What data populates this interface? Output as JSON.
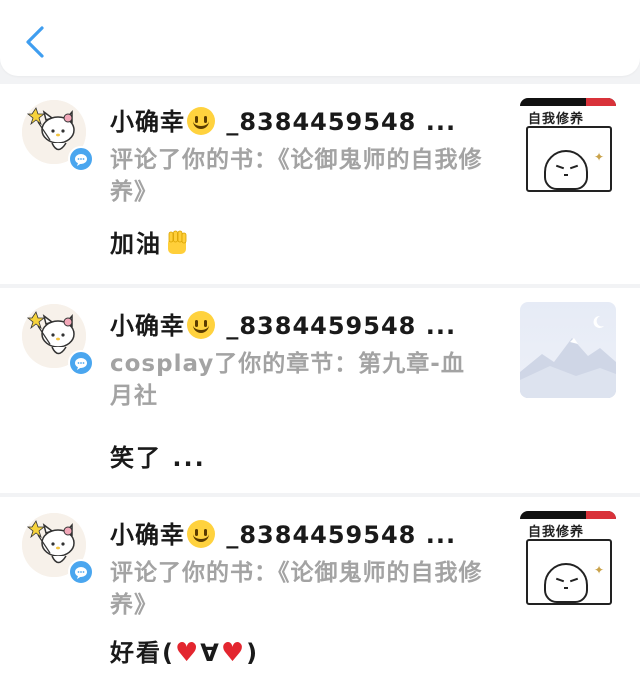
{
  "header": {
    "back_icon": "chevron-left-icon"
  },
  "items": [
    {
      "name_prefix": "小确幸",
      "name_suffix": " _8384459548 ...",
      "avatar_icon": "hello-kitty-avatar",
      "badge_icon": "comment-badge-icon",
      "action": "评论了你的书：《论御鬼师的自我修养》",
      "message": "加油",
      "message_emoji": "raised-fist-icon",
      "thumb_title": "自我修养"
    },
    {
      "name_prefix": "小确幸",
      "name_suffix": " _8384459548 ...",
      "avatar_icon": "hello-kitty-avatar",
      "badge_icon": "comment-badge-icon",
      "action": "cosplay了你的章节：第九章-血月社",
      "message": "笑了 ..."
    },
    {
      "name_prefix": "小确幸",
      "name_suffix": " _8384459548 ...",
      "avatar_icon": "hello-kitty-avatar",
      "badge_icon": "comment-badge-icon",
      "action": "评论了你的书：《论御鬼师的自我修养》",
      "message_a": "好看(",
      "message_b": "∀",
      "message_c": ")",
      "thumb_title": "自我修养"
    }
  ],
  "colors": {
    "accent": "#3f9ef0",
    "badge": "#4aa6ef",
    "muted_text": "#a3a3a3",
    "primary_text": "#1a1a1a"
  }
}
